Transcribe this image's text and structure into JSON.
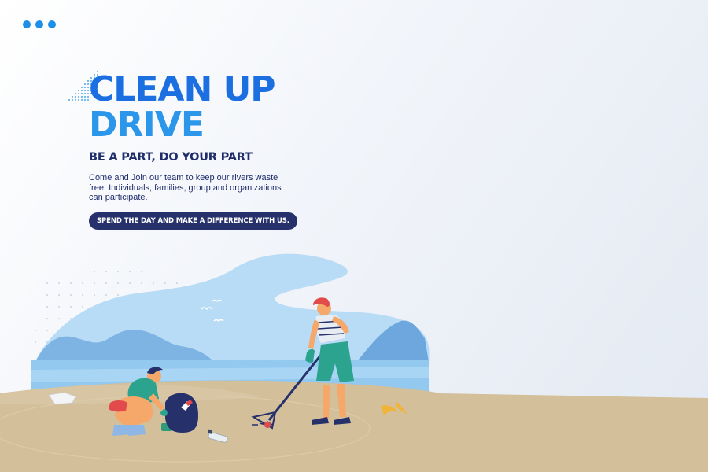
{
  "header": {
    "menu_icon": "three-dots-menu-icon",
    "accent": "#1e8fe8"
  },
  "hero": {
    "title_line1": "CLEAN UP",
    "title_line2": "DRIVE",
    "subtitle": "BE A PART, DO YOUR PART",
    "description": "Come and Join our team to keep our rivers waste free. Individuals, families, group and organizations can participate.",
    "cta_label": "SPEND THE DAY AND MAKE A DIFFERENCE WITH US."
  },
  "colors": {
    "title_primary": "#1b6fe0",
    "title_secondary": "#2b96ea",
    "text_dark": "#1f2d6b",
    "cta_background": "#26316b",
    "sand": "#d3bf9a",
    "sea": "#93c8ef",
    "sky_shape": "#b9dcf6"
  },
  "illustration": {
    "scene": "beach-cleanup-illustration",
    "items": [
      "man-picking-trash",
      "trash-bag",
      "woman-with-rake",
      "plastic-bottle",
      "banana-peel",
      "can",
      "seagulls",
      "mountains"
    ]
  }
}
